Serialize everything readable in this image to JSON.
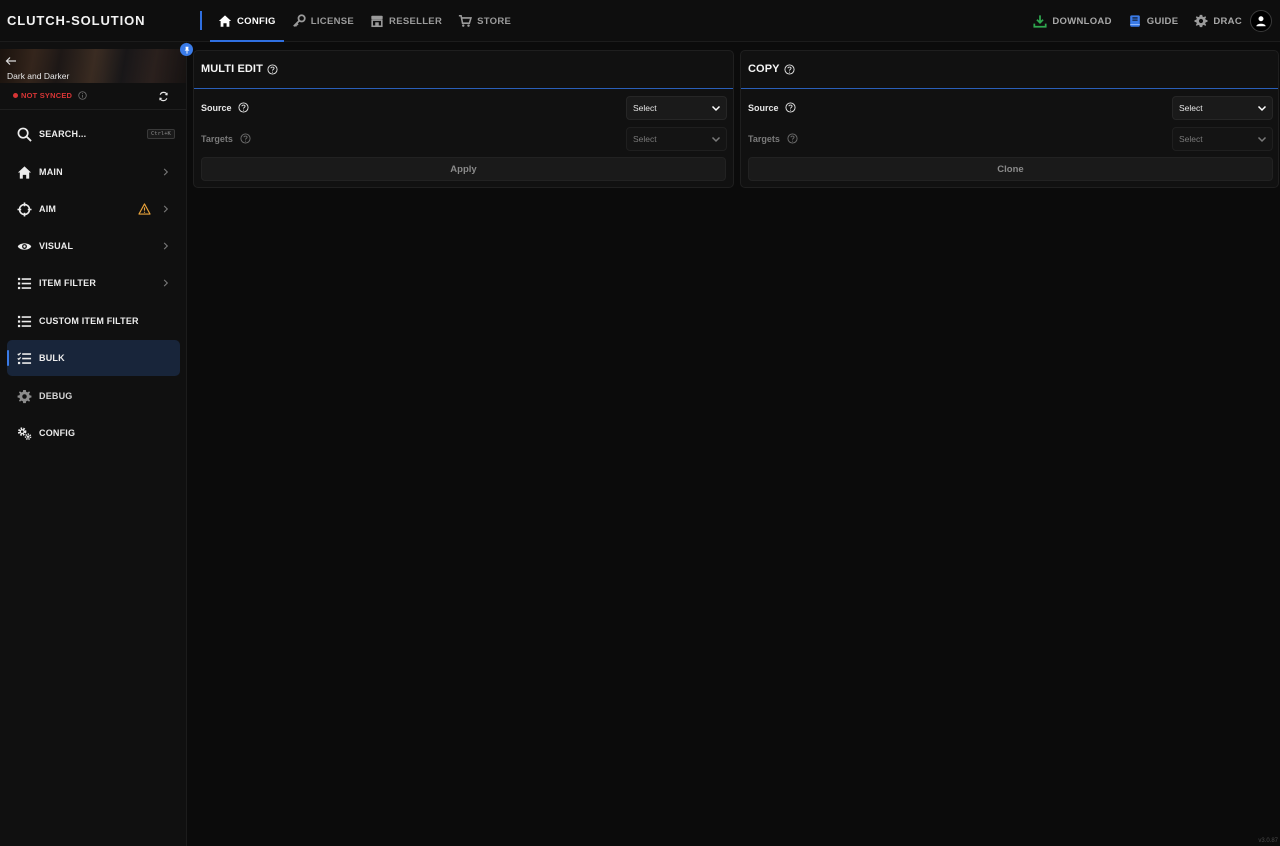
{
  "app": {
    "brand": "CLUTCH-SOLUTION",
    "version": "v3.0.87"
  },
  "topnav": {
    "tabs": [
      {
        "label": "CONFIG",
        "icon": "home-icon",
        "active": true
      },
      {
        "label": "LICENSE",
        "icon": "key-icon",
        "active": false
      },
      {
        "label": "RESELLER",
        "icon": "store-icon",
        "active": false
      },
      {
        "label": "STORE",
        "icon": "cart-icon",
        "active": false
      }
    ],
    "right": {
      "download": "DOWNLOAD",
      "guide": "GUIDE",
      "user": "DRAC"
    }
  },
  "sidebar": {
    "game_title": "Dark and Darker",
    "sync_status": "NOT SYNCED",
    "search": {
      "label": "SEARCH...",
      "shortcut": "Ctrl+K"
    },
    "items": [
      {
        "label": "MAIN",
        "icon": "home-icon",
        "has_chevron": true
      },
      {
        "label": "AIM",
        "icon": "crosshair-icon",
        "has_chevron": true,
        "warning": true
      },
      {
        "label": "VISUAL",
        "icon": "eye-icon",
        "has_chevron": true
      },
      {
        "label": "ITEM FILTER",
        "icon": "list-icon",
        "has_chevron": true
      },
      {
        "label": "CUSTOM ITEM FILTER",
        "icon": "list-icon",
        "has_chevron": false
      },
      {
        "label": "BULK",
        "icon": "checklist-icon",
        "has_chevron": false,
        "active": true
      },
      {
        "label": "DEBUG",
        "icon": "gear-icon",
        "has_chevron": false
      },
      {
        "label": "CONFIG",
        "icon": "gears-icon",
        "has_chevron": false
      }
    ]
  },
  "panels": {
    "multi_edit": {
      "title": "MULTI EDIT",
      "source_label": "Source",
      "source_value": "Select",
      "targets_label": "Targets",
      "targets_value": "Select",
      "button": "Apply"
    },
    "copy": {
      "title": "COPY",
      "source_label": "Source",
      "source_value": "Select",
      "targets_label": "Targets",
      "targets_value": "Select",
      "button": "Clone"
    }
  },
  "colors": {
    "accent": "#2f6fe0",
    "active_bg": "#18253a",
    "error": "#d73535",
    "warning": "#e8a23a",
    "download_green": "#2fa84f",
    "guide_blue": "#3a7be8"
  }
}
